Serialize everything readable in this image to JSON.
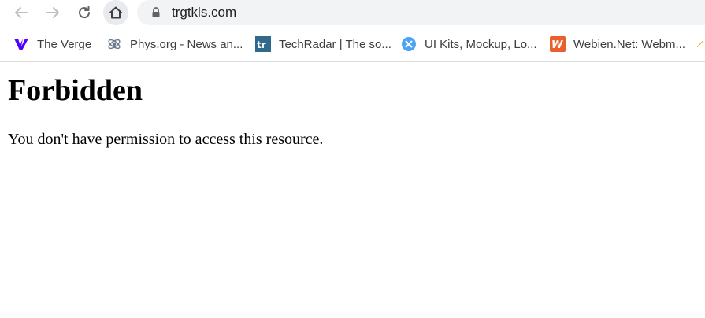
{
  "browser": {
    "address_bar": {
      "url": "trgtkls.com"
    },
    "buttons": {
      "back": "back",
      "forward": "forward",
      "reload": "reload",
      "home": "home"
    },
    "bookmarks": [
      {
        "label": "The Verge",
        "icon": "verge-icon",
        "color": "#5200ff"
      },
      {
        "label": "Phys.org - News an...",
        "icon": "physorg-icon",
        "color": "#6b7b8c"
      },
      {
        "label": "TechRadar | The so...",
        "icon": "techradar-icon",
        "color": "#2f6a8c"
      },
      {
        "label": "UI Kits, Mockup, Lo...",
        "icon": "uikits-icon",
        "color": "#4aa3f5"
      },
      {
        "label": "Webien.Net: Webm...",
        "icon": "webien-icon",
        "color": "#e8612c"
      }
    ]
  },
  "page": {
    "heading": "Forbidden",
    "message": "You don't have permission to access this resource."
  }
}
